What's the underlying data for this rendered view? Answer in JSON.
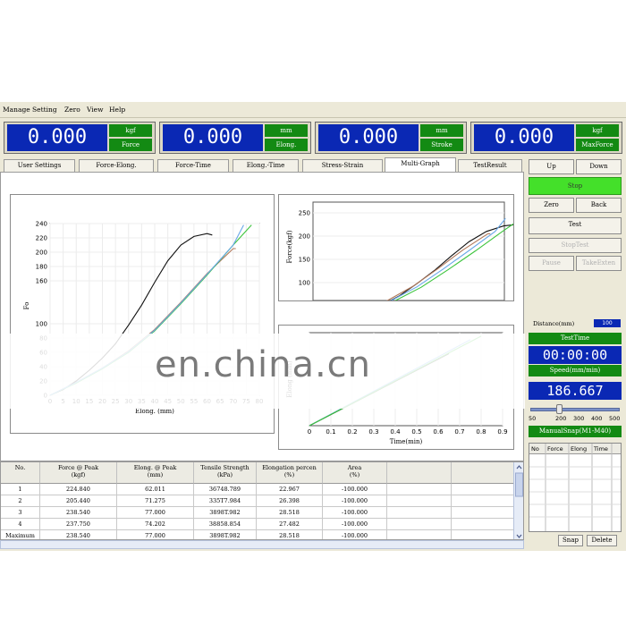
{
  "menu": [
    "Manage",
    "Setting",
    "Zero",
    "View",
    "Help"
  ],
  "readouts": [
    {
      "value": "0.000",
      "unit": "kgf",
      "name": "Force"
    },
    {
      "value": "0.000",
      "unit": "mm",
      "name": "Elong."
    },
    {
      "value": "0.000",
      "unit": "mm",
      "name": "Stroke"
    },
    {
      "value": "0.000",
      "unit": "kgf",
      "name": "MaxForce"
    }
  ],
  "tabs": [
    "User Settings",
    "Force-Elong.",
    "Force-Time",
    "Elong.-Time",
    "Stress-Strain",
    "Multi-Graph",
    "TestResult"
  ],
  "active_tab": "Multi-Graph",
  "watermark": "en.china.cn",
  "colors": {
    "blue": "#0a28b4",
    "green": "#138a13",
    "stop": "#44e02a",
    "curve_black": "#111111",
    "curve_green": "#3cc43c",
    "curve_brown": "#b0785a",
    "curve_blue": "#6aa8e8"
  },
  "chart_data": [
    {
      "type": "line",
      "xlabel": "Elong. (mm)",
      "ylabel": "Fo",
      "x_ticks": [
        "0",
        "5",
        "10",
        "15",
        "20",
        "25",
        "30",
        "35",
        "40",
        "45",
        "50",
        "55",
        "60",
        "65",
        "70",
        "75",
        "80"
      ],
      "y_ticks": [
        "240",
        "220",
        "200",
        "180",
        "160",
        "100",
        "80",
        "60",
        "40",
        "20",
        "0"
      ],
      "xlim": [
        0,
        80
      ],
      "ylim": [
        0,
        240
      ],
      "series": [
        {
          "x": [
            0,
            5,
            10,
            15,
            20,
            25,
            30,
            35,
            40,
            45,
            50,
            55,
            60,
            62
          ],
          "y": [
            0,
            8,
            20,
            35,
            52,
            72,
            98,
            126,
            158,
            188,
            210,
            222,
            226,
            224
          ]
        },
        {
          "x": [
            0,
            10,
            20,
            30,
            40,
            50,
            60,
            70,
            71
          ],
          "y": [
            0,
            18,
            38,
            62,
            92,
            130,
            170,
            205,
            205
          ]
        },
        {
          "x": [
            0,
            10,
            20,
            30,
            40,
            50,
            60,
            70,
            77
          ],
          "y": [
            0,
            17,
            37,
            60,
            90,
            128,
            168,
            210,
            238
          ]
        },
        {
          "x": [
            0,
            10,
            20,
            30,
            40,
            50,
            60,
            70,
            74
          ],
          "y": [
            0,
            18,
            38,
            61,
            91,
            129,
            169,
            210,
            238
          ]
        }
      ]
    },
    {
      "type": "line",
      "ylabel": "Force(kgf)",
      "y_ticks": [
        "250",
        "200",
        "150",
        "100"
      ],
      "ylim": [
        0,
        250
      ]
    },
    {
      "type": "line",
      "xlabel": "Time(min)",
      "ylabel": "Elong (mm)",
      "x_ticks": [
        "0",
        "0.1",
        "0.2",
        "0.3",
        "0.4",
        "0.5",
        "0.6",
        "0.7",
        "0.8",
        "0.9"
      ],
      "xlim": [
        0,
        0.9
      ],
      "ylim": [
        0,
        80
      ],
      "series": [
        {
          "x": [
            0,
            0.65
          ],
          "y": [
            0,
            62
          ]
        },
        {
          "x": [
            0,
            0.75
          ],
          "y": [
            0,
            74
          ]
        },
        {
          "x": [
            0,
            0.8
          ],
          "y": [
            0,
            77
          ]
        }
      ]
    }
  ],
  "table": {
    "headers": [
      "No.",
      "Force @ Peak\n(kgf)",
      "Elong. @ Peak\n(mm)",
      "Tensile Strength\n(kPa)",
      "Elongation percen\n(%)",
      "Area\n(%)"
    ],
    "rows": [
      [
        "1",
        "224.840",
        "62.011",
        "36748.789",
        "22.967",
        "-100.000"
      ],
      [
        "2",
        "205.440",
        "71.275",
        "335T7.984",
        "26.398",
        "-100.000"
      ],
      [
        "3",
        "238.540",
        "77.000",
        "3898T.982",
        "28.518",
        "-100.000"
      ],
      [
        "4",
        "237.750",
        "74.202",
        "38858.854",
        "27.482",
        "-100.000"
      ],
      [
        "Maximum",
        "238.540",
        "77.000",
        "3898T.982",
        "28.518",
        "-100.000"
      ]
    ]
  },
  "controls": {
    "up": "Up",
    "down": "Down",
    "stop": "Stop",
    "zero": "Zero",
    "back": "Back",
    "test": "Test",
    "stoptest": "StopTest",
    "pause": "Pause",
    "takeexten": "TakeExten",
    "distance_label": "Distance(mm)",
    "distance_value": "100",
    "testtime_label": "TestTime",
    "testtime": "00:00:00",
    "speed_label": "Speed(mm/min)",
    "speed": "186.667",
    "slider_ticks": [
      "50",
      "200",
      "300",
      "400",
      "500"
    ],
    "slider_value": 186.667,
    "manualsnap": "ManualSnap(M1-M40)",
    "snap_headers": [
      "No",
      "Force",
      "Elong",
      "Time"
    ],
    "snap": "Snap",
    "delete": "Delete"
  }
}
